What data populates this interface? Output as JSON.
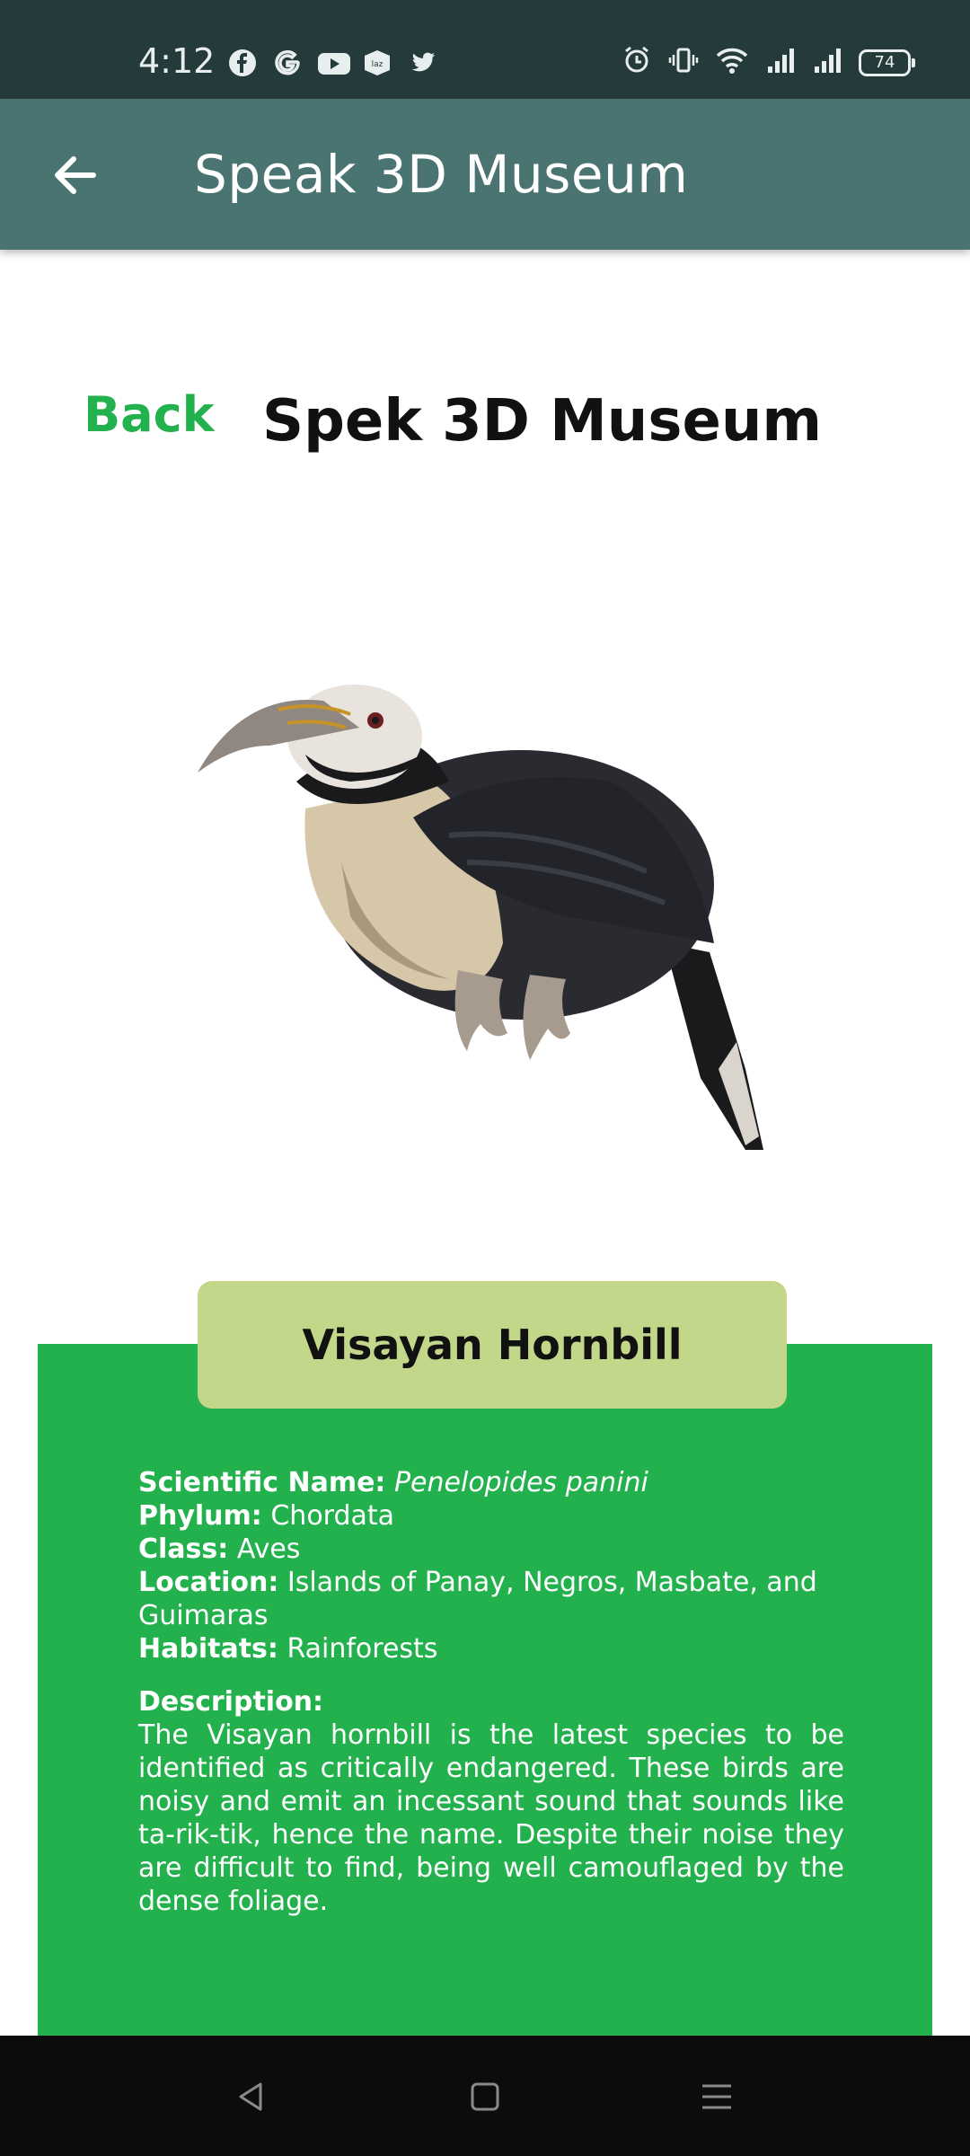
{
  "status_bar": {
    "time": "4:12",
    "app_icons": [
      "facebook-icon",
      "google-icon",
      "youtube-icon",
      "lazada-icon",
      "twitter-icon"
    ],
    "system_icons": [
      "alarm-icon",
      "vibrate-icon",
      "wifi-icon",
      "signal-icon",
      "signal-icon"
    ],
    "battery": "74"
  },
  "app_bar": {
    "title": "Speak 3D Museum",
    "background": "#4a7472"
  },
  "header": {
    "back_label": "Back",
    "title": "Spek 3D Museum",
    "accent": "#22b14c"
  },
  "specimen": {
    "name": "Visayan Hornbill",
    "scientific_label": "Scientific Name:",
    "scientific_value": "Penelopides panini",
    "phylum_label": "Phylum:",
    "phylum_value": "Chordata",
    "class_label": "Class:",
    "class_value": "Aves",
    "location_label": "Location:",
    "location_value": "Islands of Panay, Negros, Masbate, and Guimaras",
    "habitats_label": "Habitats:",
    "habitats_value": "Rainforests",
    "description_label": "Description:",
    "description_value": "The Visayan hornbill is the latest species to be identified as critically endangered. These birds are noisy and emit an incessant sound that sounds like ta-rik-tik, hence the name. Despite their noise they are difficult to find, being well camouflaged by the dense foliage."
  },
  "nav_bar": {
    "buttons": [
      "back-triangle-icon",
      "home-square-icon",
      "menu-lines-icon"
    ]
  }
}
